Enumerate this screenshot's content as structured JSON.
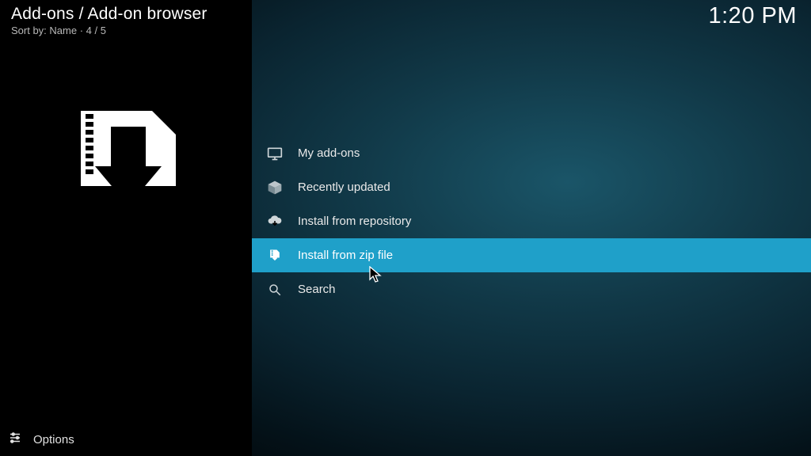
{
  "header": {
    "breadcrumb": "Add-ons / Add-on browser",
    "sort_prefix": "Sort by: ",
    "sort_value": "Name",
    "sort_sep": "  ·  ",
    "position": "4 / 5"
  },
  "clock": "1:20 PM",
  "menu": {
    "items": [
      {
        "label": "My add-ons",
        "icon": "monitor-icon",
        "selected": false
      },
      {
        "label": "Recently updated",
        "icon": "box-open-icon",
        "selected": false
      },
      {
        "label": "Install from repository",
        "icon": "cloud-down-icon",
        "selected": false
      },
      {
        "label": "Install from zip file",
        "icon": "zip-down-icon",
        "selected": true
      },
      {
        "label": "Search",
        "icon": "search-icon",
        "selected": false
      }
    ]
  },
  "footer": {
    "options_label": "Options"
  },
  "colors": {
    "highlight": "#1fa0c9"
  }
}
